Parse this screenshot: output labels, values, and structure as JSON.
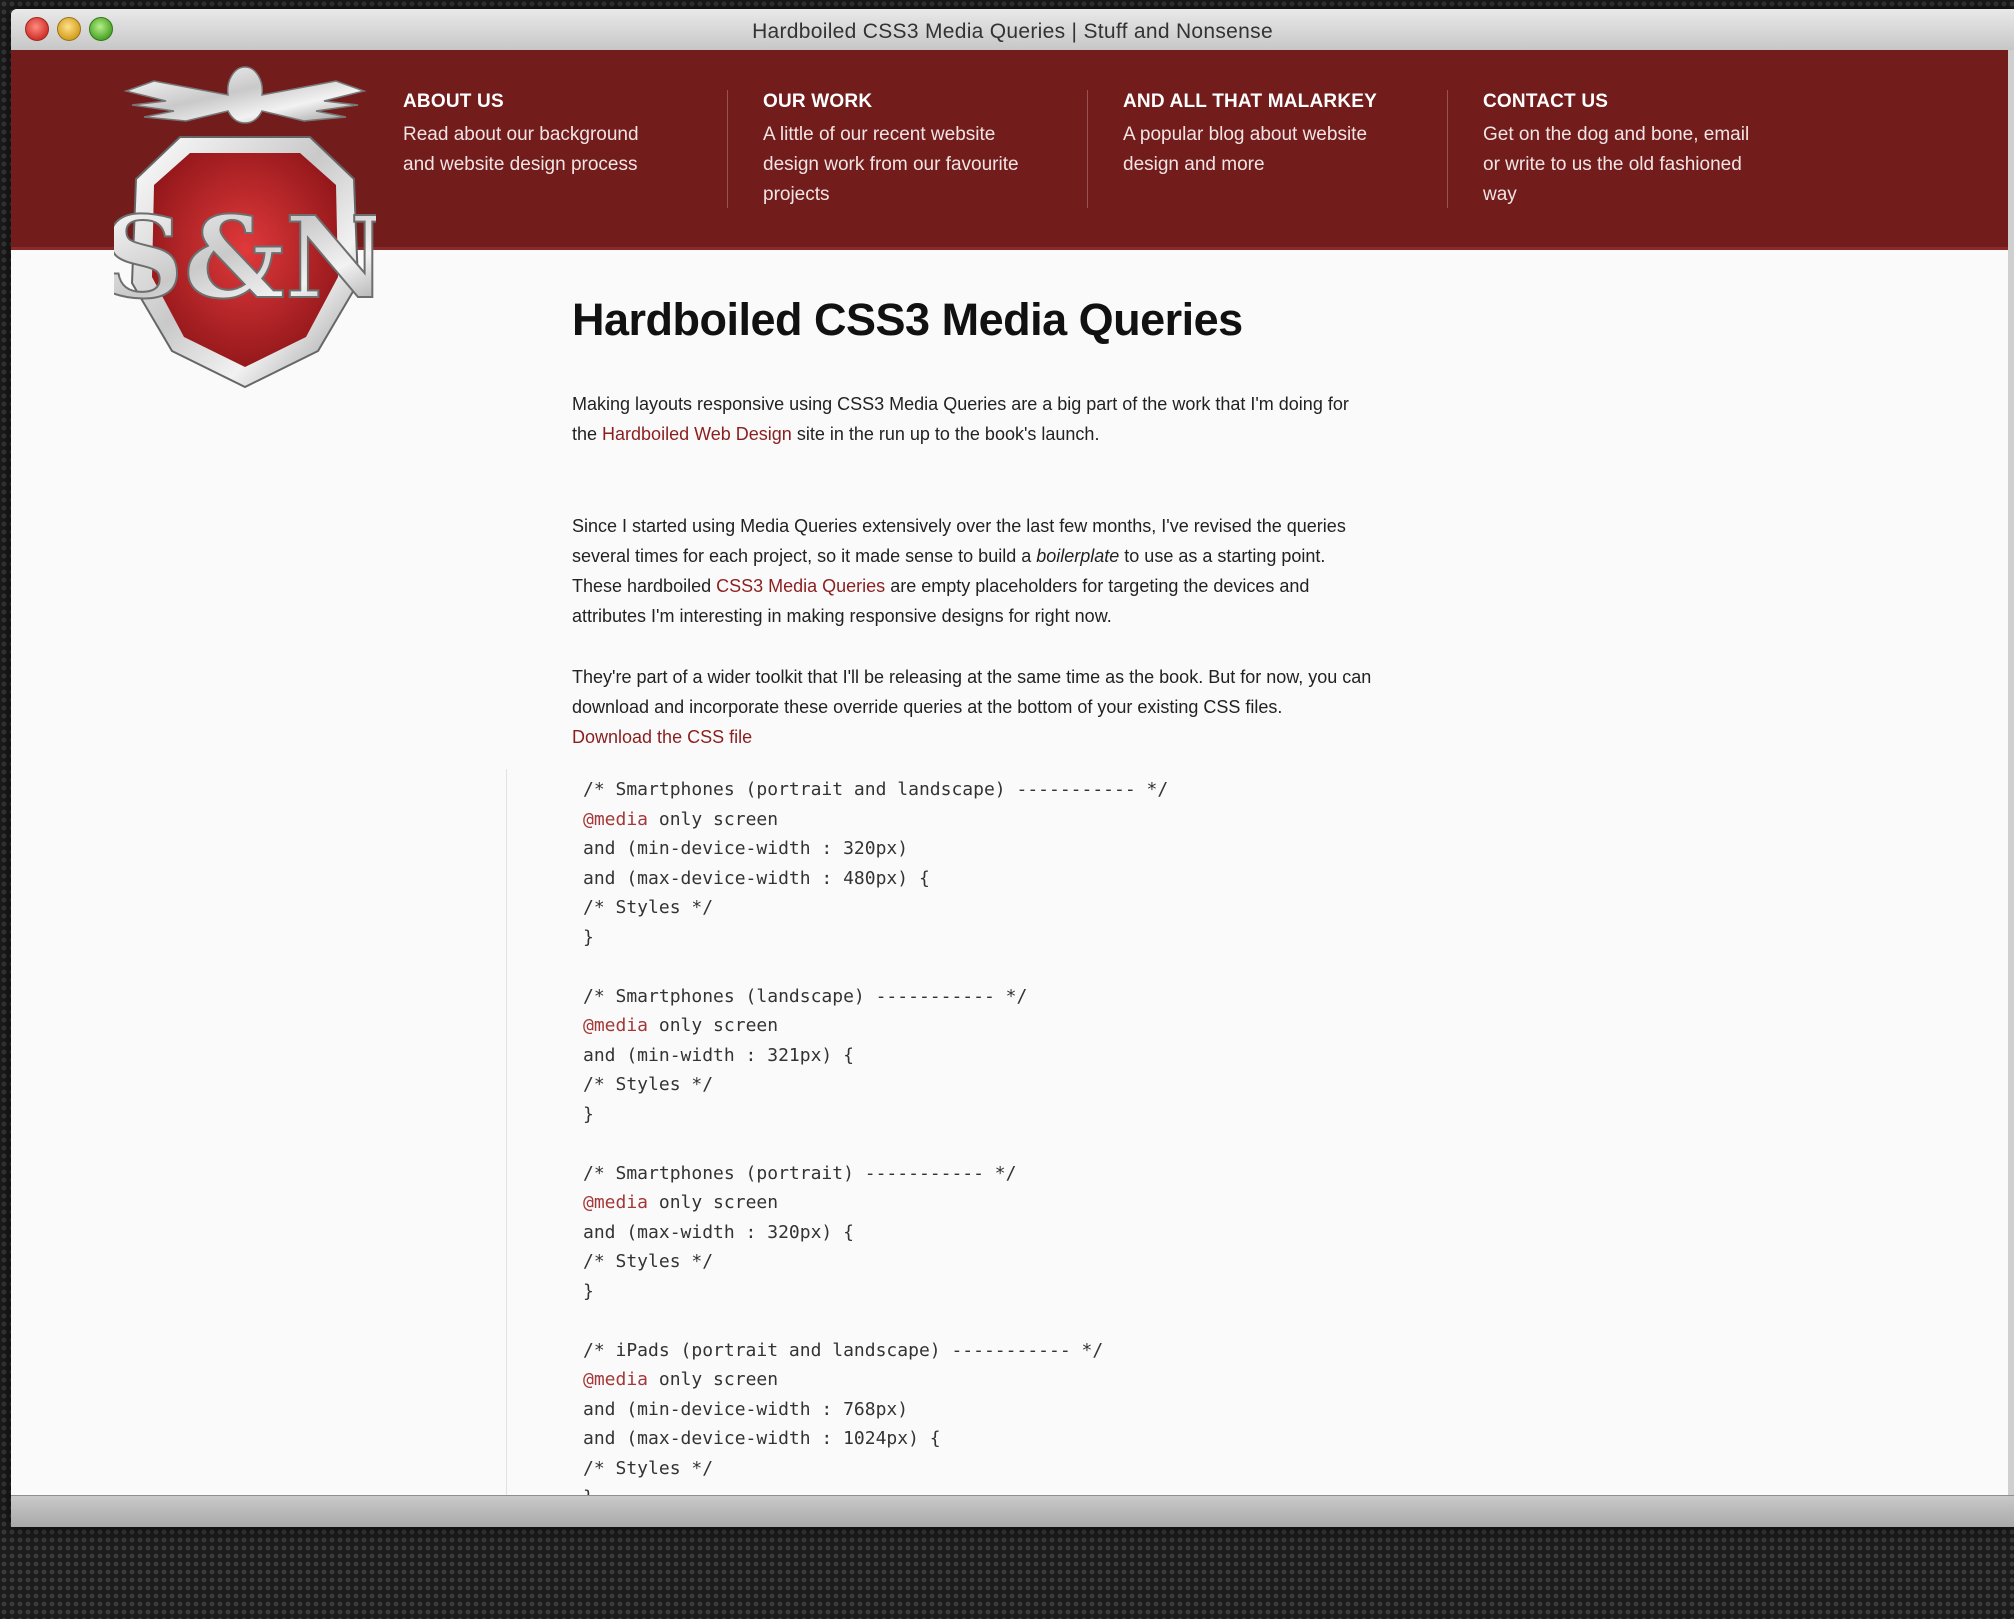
{
  "window": {
    "title": "Hardboiled CSS3 Media Queries | Stuff and Nonsense"
  },
  "logo": {
    "text": "S&N"
  },
  "nav": [
    {
      "title": "ABOUT US",
      "lines": [
        "Read about our background",
        "and website design process"
      ]
    },
    {
      "title": "OUR WORK",
      "lines": [
        "A little of our recent website",
        "design work from our favourite",
        "projects"
      ]
    },
    {
      "title": "AND ALL THAT MALARKEY",
      "lines": [
        "A popular blog about website",
        "design and more"
      ]
    },
    {
      "title": "CONTACT US",
      "lines": [
        "Get on the dog and bone, email",
        "or write to us the old fashioned",
        "way"
      ]
    }
  ],
  "article": {
    "title": "Hardboiled CSS3 Media Queries",
    "p1": {
      "line1": "Making layouts responsive using CSS3 Media Queries are a big part of the work that I'm doing for",
      "line2_before": "the ",
      "line2_link": "Hardboiled Web Design",
      "line2_after": " site in the run up to the book's launch."
    },
    "p2": {
      "line1": "Since I started using Media Queries extensively over the last few months, I've revised the queries",
      "line2_before": "several times for each project, so it made sense to build a ",
      "line2_em": "boilerplate",
      "line2_after": " to use as a starting point.",
      "line3_before": "These hardboiled ",
      "line3_link": "CSS3 Media Queries",
      "line3_after": " are empty placeholders for targeting the devices and",
      "line4": "attributes I'm interesting in making responsive designs for right now."
    },
    "p3": {
      "line1": "They're part of a wider toolkit that I'll be releasing at the same time as the book. But for now, you can",
      "line2": "download and incorporate these override queries at the bottom of your existing CSS files.",
      "link": "Download the CSS file"
    },
    "code": [
      {
        "pre": "/* Smartphones (portrait and landscape) ----------- */"
      },
      {
        "at": "@media",
        "pre": " only screen"
      },
      {
        "pre": "and (min-device-width : 320px)"
      },
      {
        "pre": "and (max-device-width : 480px) {"
      },
      {
        "pre": "/* Styles */"
      },
      {
        "pre": "}"
      },
      {
        "pre": ""
      },
      {
        "pre": "/* Smartphones (landscape) ----------- */"
      },
      {
        "at": "@media",
        "pre": " only screen"
      },
      {
        "pre": "and (min-width : 321px) {"
      },
      {
        "pre": "/* Styles */"
      },
      {
        "pre": "}"
      },
      {
        "pre": ""
      },
      {
        "pre": "/* Smartphones (portrait) ----------- */"
      },
      {
        "at": "@media",
        "pre": " only screen"
      },
      {
        "pre": "and (max-width : 320px) {"
      },
      {
        "pre": "/* Styles */"
      },
      {
        "pre": "}"
      },
      {
        "pre": ""
      },
      {
        "pre": "/* iPads (portrait and landscape) ----------- */"
      },
      {
        "at": "@media",
        "pre": " only screen"
      },
      {
        "pre": "and (min-device-width : 768px)"
      },
      {
        "pre": "and (max-device-width : 1024px) {"
      },
      {
        "pre": "/* Styles */"
      },
      {
        "pre": "}"
      }
    ]
  },
  "colors": {
    "masthead": "#731c1c",
    "link": "#8a1f1f",
    "page": "#fafafa"
  }
}
